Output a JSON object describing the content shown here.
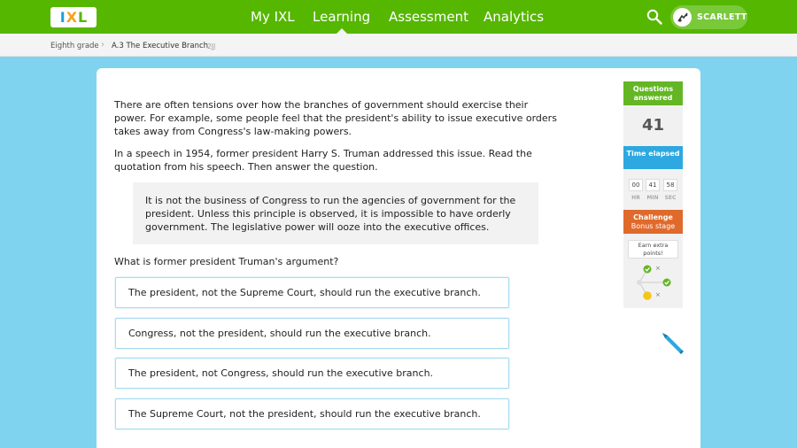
{
  "header": {
    "logo": [
      "I",
      "X",
      "L"
    ],
    "nav": [
      "My IXL",
      "Learning",
      "Assessment",
      "Analytics"
    ],
    "active_nav": "Learning",
    "user_name": "SCARLETT",
    "search_icon": "search-icon",
    "brand_color": "#56b700"
  },
  "breadcrumb": {
    "grade": "Eighth grade",
    "separator": "›",
    "skill": "A.3 The Executive Branch",
    "code": "2JJ"
  },
  "question": {
    "intro1": "There are often tensions over how the branches of government should exercise their power. For example, some people feel that the president's ability to issue executive orders takes away from Congress's law-making powers.",
    "intro2": "In a speech in 1954, former president Harry S. Truman addressed this issue. Read the quotation from his speech. Then answer the question.",
    "quote": "It is not the business of Congress to run the agencies of government for the president. Unless this principle is observed, it is impossible to have orderly government. The legislative power will ooze into the executive offices.",
    "prompt": "What is former president Truman's argument?",
    "answers": [
      "The president, not the Supreme Court, should run the executive branch.",
      "Congress, not the president, should run the executive branch.",
      "The president, not Congress, should run the executive branch.",
      "The Supreme Court, not the president, should run the executive branch."
    ]
  },
  "sidebar": {
    "questions_label": "Questions answered",
    "questions_value": "41",
    "time_label": "Time elapsed",
    "time": {
      "hr": "00",
      "min": "41",
      "sec": "58"
    },
    "time_units": {
      "hr": "HR",
      "min": "MIN",
      "sec": "SEC"
    },
    "challenge_label": "Challenge",
    "challenge_sub": "Bonus stage",
    "earn": "Earn extra points!",
    "x_mark": "×",
    "colors": {
      "questions": "#64b624",
      "time": "#2da8e0",
      "challenge": "#e06a2c"
    }
  },
  "pencil_icon": "pencil-icon"
}
